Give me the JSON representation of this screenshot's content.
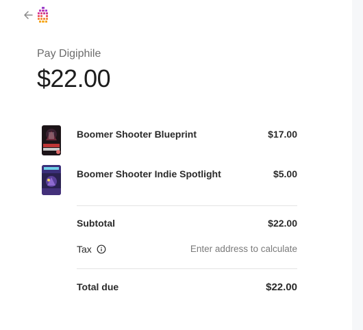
{
  "header": {
    "back_icon": "arrow-left-icon",
    "logo_icon": "digiphile-logo-icon"
  },
  "merchant": {
    "label": "Pay Digiphile"
  },
  "total_amount": "$22.00",
  "items": [
    {
      "name": "Boomer Shooter Blueprint",
      "price": "$17.00",
      "thumb_caption": "BEYOND CITADEL"
    },
    {
      "name": "Boomer Shooter Indie Spotlight",
      "price": "$5.00",
      "thumb_caption": "WARLOCK"
    }
  ],
  "summary": {
    "subtotal_label": "Subtotal",
    "subtotal_value": "$22.00",
    "tax_label": "Tax",
    "tax_info_icon": "info-icon",
    "tax_value": "Enter address to calculate",
    "total_label": "Total due",
    "total_value": "$22.00"
  },
  "colors": {
    "logo_top": "#b13cc9",
    "logo_bottom": "#f5a623",
    "divider": "#e3e3e3",
    "muted_text": "#7a7a7a"
  }
}
